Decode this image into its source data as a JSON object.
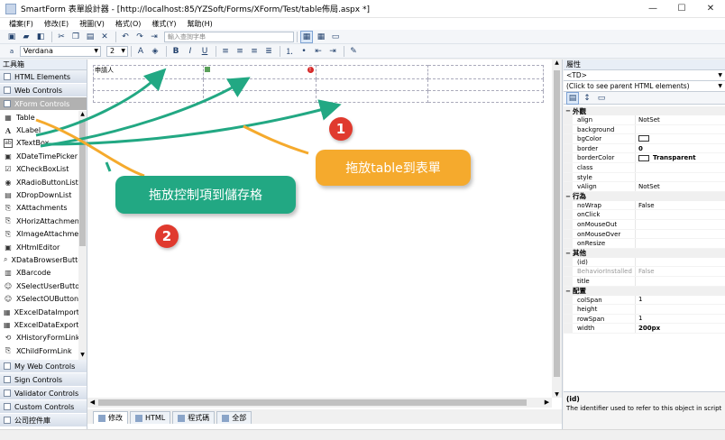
{
  "window": {
    "title": "SmartForm 表單設計器 - [http://localhost:85/YZSoft/Forms/XForm/Test/table佈局.aspx *]",
    "minimize": "—",
    "maximize": "☐",
    "close": "✕"
  },
  "menu": [
    "檔案(F)",
    "修改(E)",
    "視圖(V)",
    "格式(O)",
    "樣式(Y)",
    "幫助(H)"
  ],
  "toolbar": {
    "command_placeholder": "輸入查詢字串",
    "font_name": "Verdana",
    "font_size": "2",
    "bold": "B",
    "italic": "I",
    "underline": "U"
  },
  "toolbox": {
    "header": "工具箱",
    "categories_top": [
      "HTML Elements",
      "Web Controls",
      "XForm Controls"
    ],
    "items": [
      {
        "icon": "▦",
        "label": "Table"
      },
      {
        "icon": "A",
        "label": "XLabel"
      },
      {
        "icon": "ab",
        "label": "XTextBox"
      },
      {
        "icon": "▣",
        "label": "XDateTimePicker"
      },
      {
        "icon": "☑",
        "label": "XCheckBoxList"
      },
      {
        "icon": "◉",
        "label": "XRadioButtonList"
      },
      {
        "icon": "▤",
        "label": "XDropDownList"
      },
      {
        "icon": "⎘",
        "label": "XAttachments"
      },
      {
        "icon": "⎘",
        "label": "XHorizAttachments"
      },
      {
        "icon": "⎘",
        "label": "XImageAttachment"
      },
      {
        "icon": "▣",
        "label": "XHtmlEditor"
      },
      {
        "icon": "⌕",
        "label": "XDataBrowserButton"
      },
      {
        "icon": "▥",
        "label": "XBarcode"
      },
      {
        "icon": "☺",
        "label": "XSelectUserButton"
      },
      {
        "icon": "☺",
        "label": "XSelectOUButton"
      },
      {
        "icon": "▦",
        "label": "XExcelDataImportB..."
      },
      {
        "icon": "▦",
        "label": "XExcelDataExportB..."
      },
      {
        "icon": "⟲",
        "label": "XHistoryFormLink"
      },
      {
        "icon": "⎘",
        "label": "XChildFormLink"
      }
    ],
    "categories_bottom": [
      "My Web Controls",
      "Sign Controls",
      "Validator Controls",
      "Custom Controls",
      "公司控件庫"
    ]
  },
  "design": {
    "cell_label": "申請人",
    "error_mark": "!",
    "tabs": [
      "修改",
      "HTML",
      "程式碼",
      "全部"
    ]
  },
  "annotations": {
    "orange_callout": "拖放table到表單",
    "green_callout": "拖放控制項到儲存格",
    "badge_1": "1",
    "badge_2": "2",
    "colors": {
      "orange": "#f5aa2d",
      "green": "#22a883",
      "red": "#e03a2e"
    }
  },
  "properties": {
    "header": "屬性",
    "selected_object": "<TD>",
    "parent_hint": "(Click to see parent HTML elements)",
    "categories": [
      {
        "name": "外觀",
        "rows": [
          {
            "name": "align",
            "value": "NotSet"
          },
          {
            "name": "background",
            "value": ""
          },
          {
            "name": "bgColor",
            "value": "",
            "swatch": true
          },
          {
            "name": "border",
            "value": "0",
            "bold": true
          },
          {
            "name": "borderColor",
            "value": "Transparent",
            "swatch": true,
            "bold": true
          },
          {
            "name": "class",
            "value": ""
          },
          {
            "name": "style",
            "value": ""
          },
          {
            "name": "vAlign",
            "value": "NotSet"
          }
        ]
      },
      {
        "name": "行為",
        "rows": [
          {
            "name": "noWrap",
            "value": "False"
          },
          {
            "name": "onClick",
            "value": ""
          },
          {
            "name": "onMouseOut",
            "value": ""
          },
          {
            "name": "onMouseOver",
            "value": ""
          },
          {
            "name": "onResize",
            "value": ""
          }
        ]
      },
      {
        "name": "其他",
        "rows": [
          {
            "name": "(id)",
            "value": ""
          },
          {
            "name": "BehaviorInstalled",
            "value": "False",
            "dim": true
          },
          {
            "name": "title",
            "value": ""
          }
        ]
      },
      {
        "name": "配置",
        "rows": [
          {
            "name": "colSpan",
            "value": "1"
          },
          {
            "name": "height",
            "value": ""
          },
          {
            "name": "rowSpan",
            "value": "1"
          },
          {
            "name": "width",
            "value": "200px",
            "bold": true
          }
        ]
      }
    ],
    "description_title": "(id)",
    "description_text": "The identifier used to refer to this object in script"
  }
}
